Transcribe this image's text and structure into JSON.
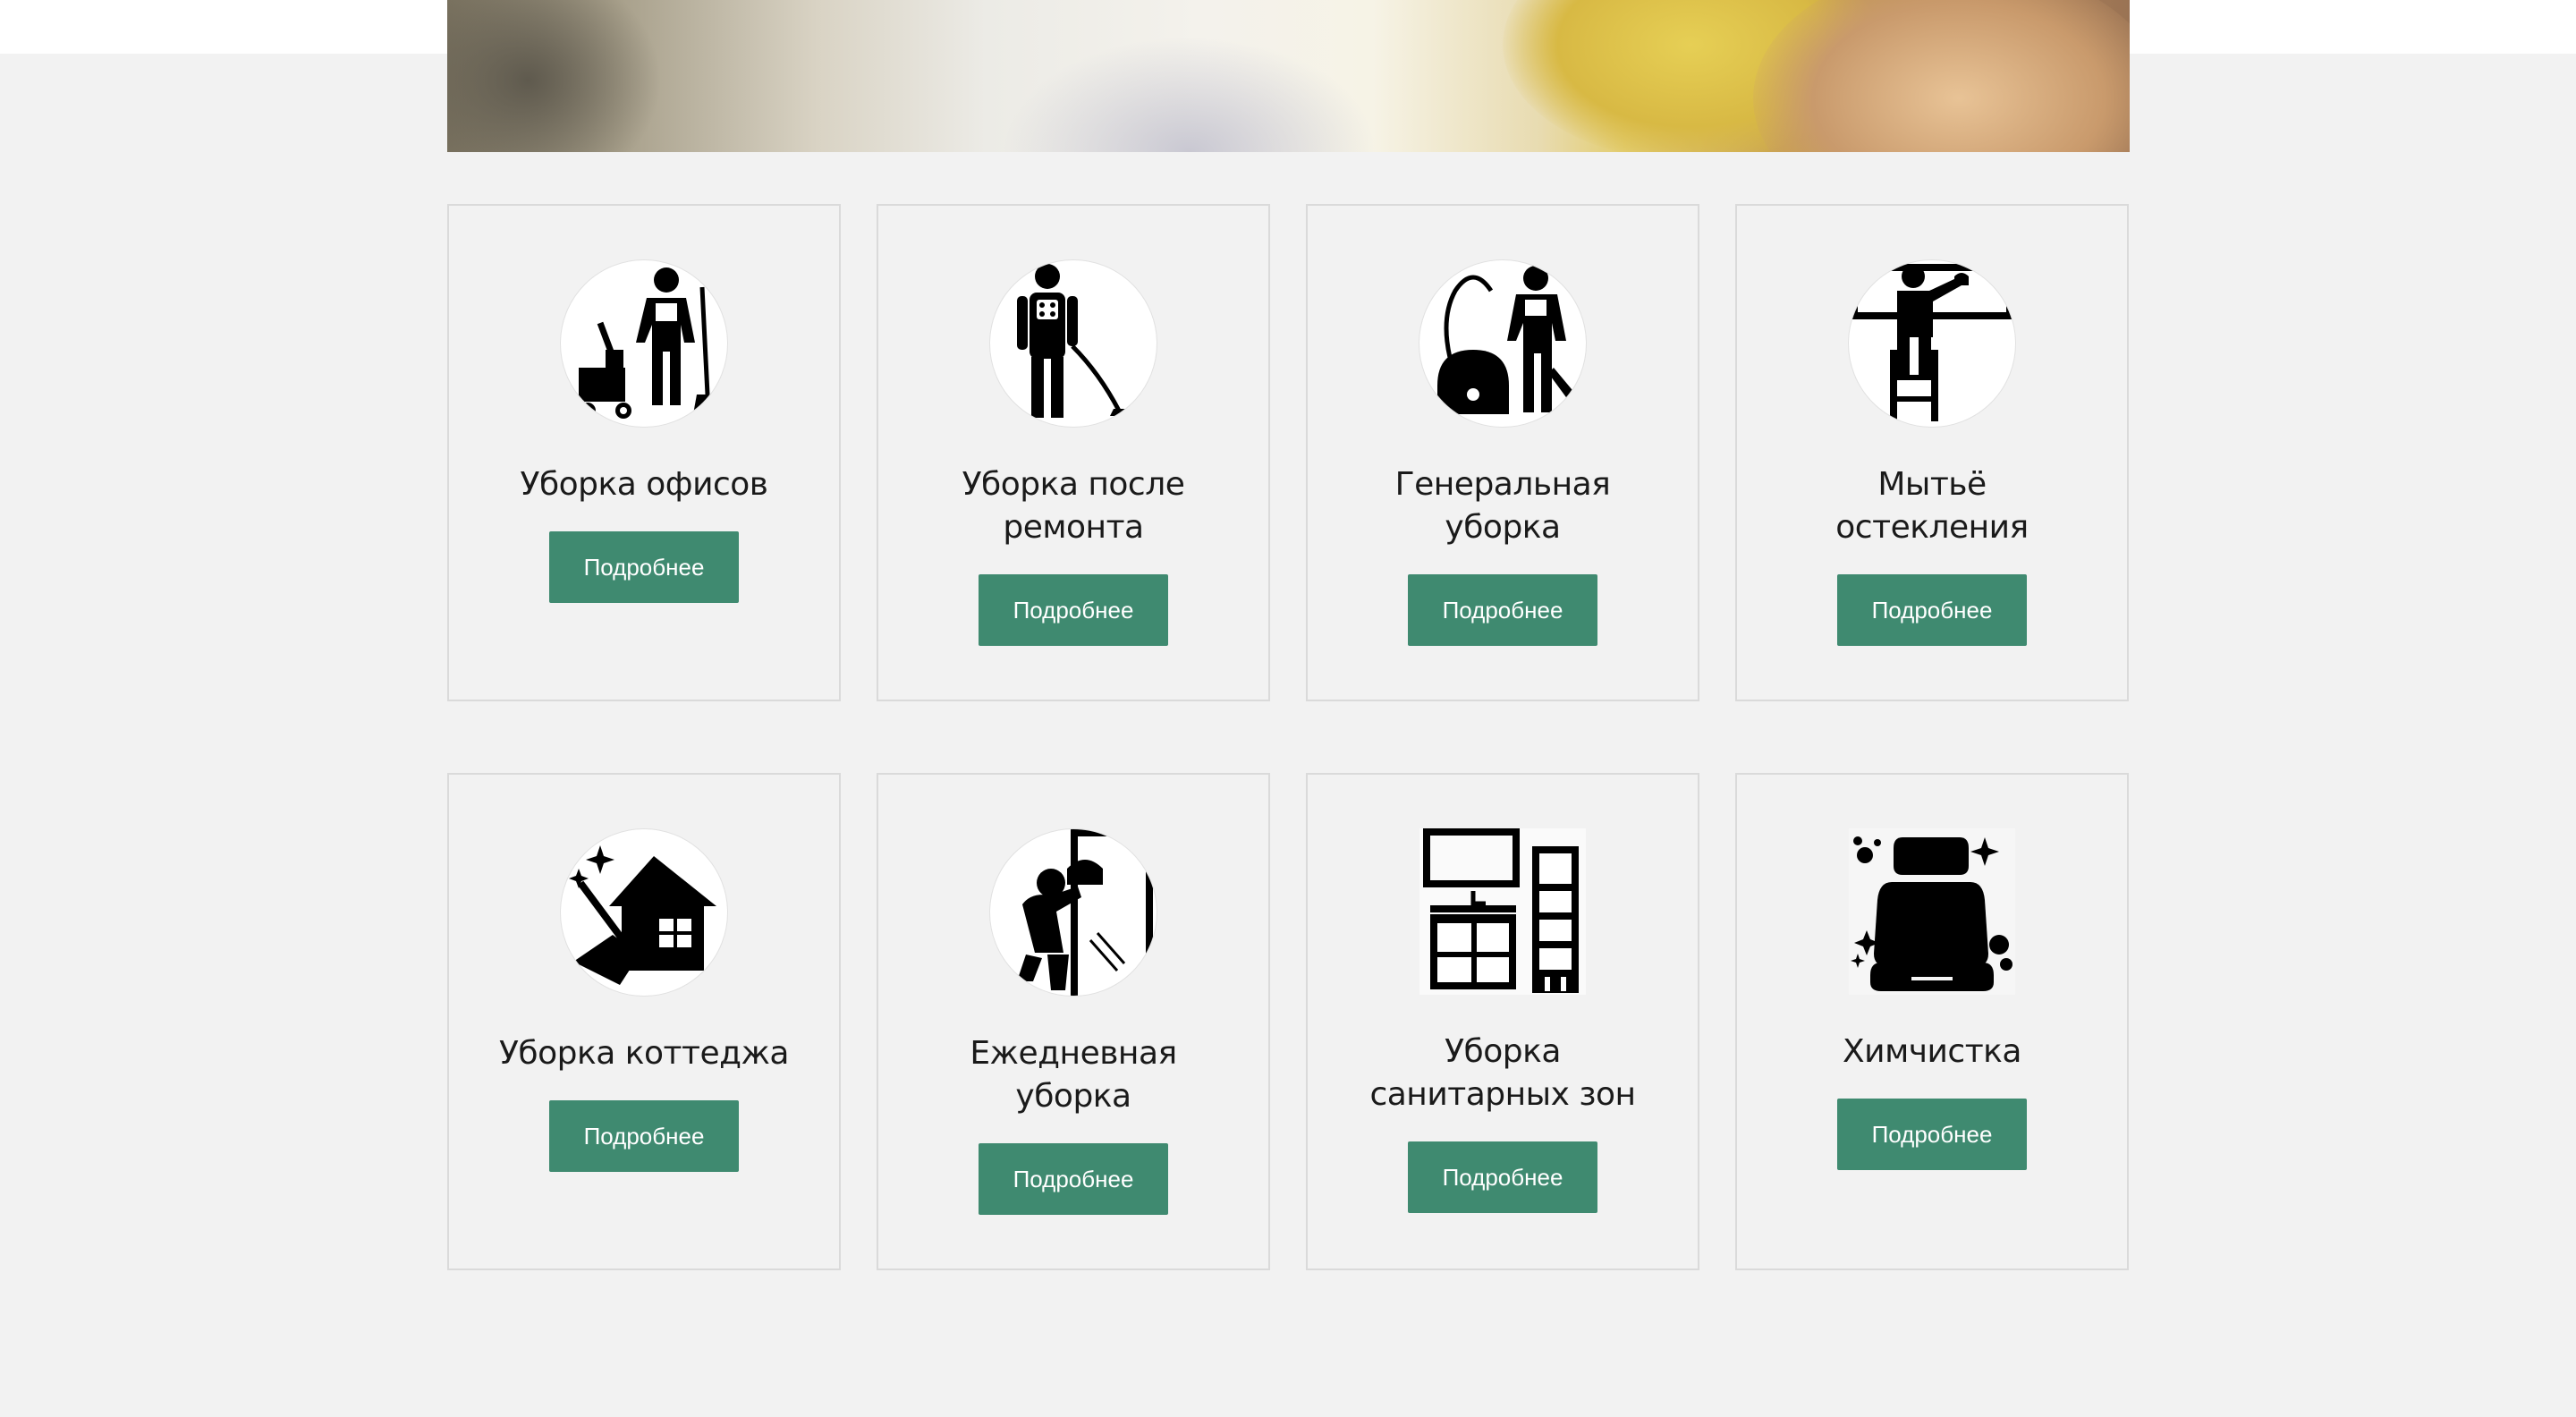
{
  "hero": {
    "slider": {
      "count": 2,
      "active": 2
    }
  },
  "colors": {
    "accent": "#3f8a70",
    "background": "#f2f2f2"
  },
  "services": [
    {
      "title": "Уборка офисов",
      "button": "Подробнее",
      "icon": "office-cleaner-icon"
    },
    {
      "title": "Уборка после ремонта",
      "button": "Подробнее",
      "icon": "vacuum-worker-icon"
    },
    {
      "title": "Генеральная уборка",
      "button": "Подробнее",
      "icon": "vacuum-cleaner-icon"
    },
    {
      "title": "Мытьё остекления",
      "button": "Подробнее",
      "icon": "window-washer-icon"
    },
    {
      "title": "Уборка коттеджа",
      "button": "Подробнее",
      "icon": "house-broom-icon"
    },
    {
      "title": "Ежедневная уборка",
      "button": "Подробнее",
      "icon": "mirror-cleaner-icon"
    },
    {
      "title": "Уборка санитарных зон",
      "button": "Подробнее",
      "icon": "bathroom-icon"
    },
    {
      "title": "Химчистка",
      "button": "Подробнее",
      "icon": "car-seat-icon"
    }
  ]
}
